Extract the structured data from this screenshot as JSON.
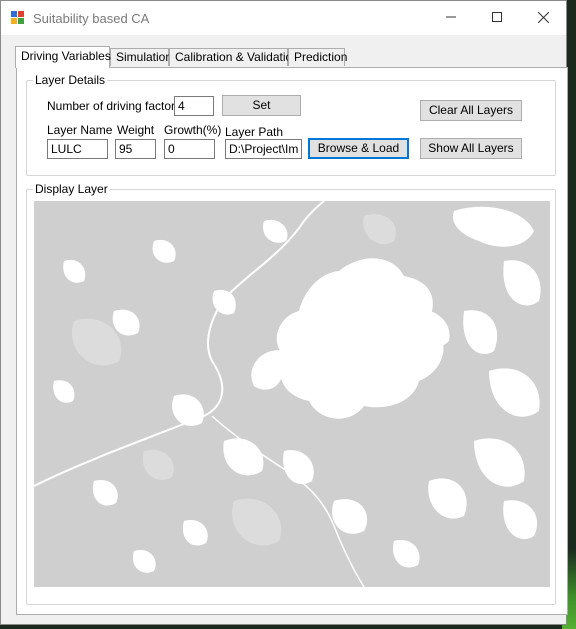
{
  "window": {
    "title": "Suitability based CA",
    "controls": {
      "minimize": "—",
      "maximize": "☐",
      "close": "✕"
    }
  },
  "tabs": [
    {
      "label": "Driving Variables",
      "active": true
    },
    {
      "label": "Simulation",
      "active": false
    },
    {
      "label": "Calibration & Validation",
      "active": false
    },
    {
      "label": "Prediction",
      "active": false
    }
  ],
  "layer_details": {
    "legend": "Layer Details",
    "num_factors_label": "Number of driving factors",
    "num_factors_value": "4",
    "set_button": "Set",
    "clear_all_button": "Clear All Layers",
    "show_all_button": "Show All Layers",
    "layer_name_label": "Layer Name",
    "layer_name_value": "LULC",
    "weight_label": "Weight",
    "weight_value": "95",
    "growth_label": "Growth(%)",
    "growth_value": "0",
    "layer_path_label": "Layer Path",
    "layer_path_value": "D:\\Project\\Ima",
    "browse_button": "Browse & Load"
  },
  "display_layer": {
    "legend": "Display Layer",
    "map_icon": "land-use-raster-map",
    "colors": {
      "background": "#cfcfcf",
      "built_up": "#ffffff",
      "water": "#dcdcdc"
    }
  }
}
